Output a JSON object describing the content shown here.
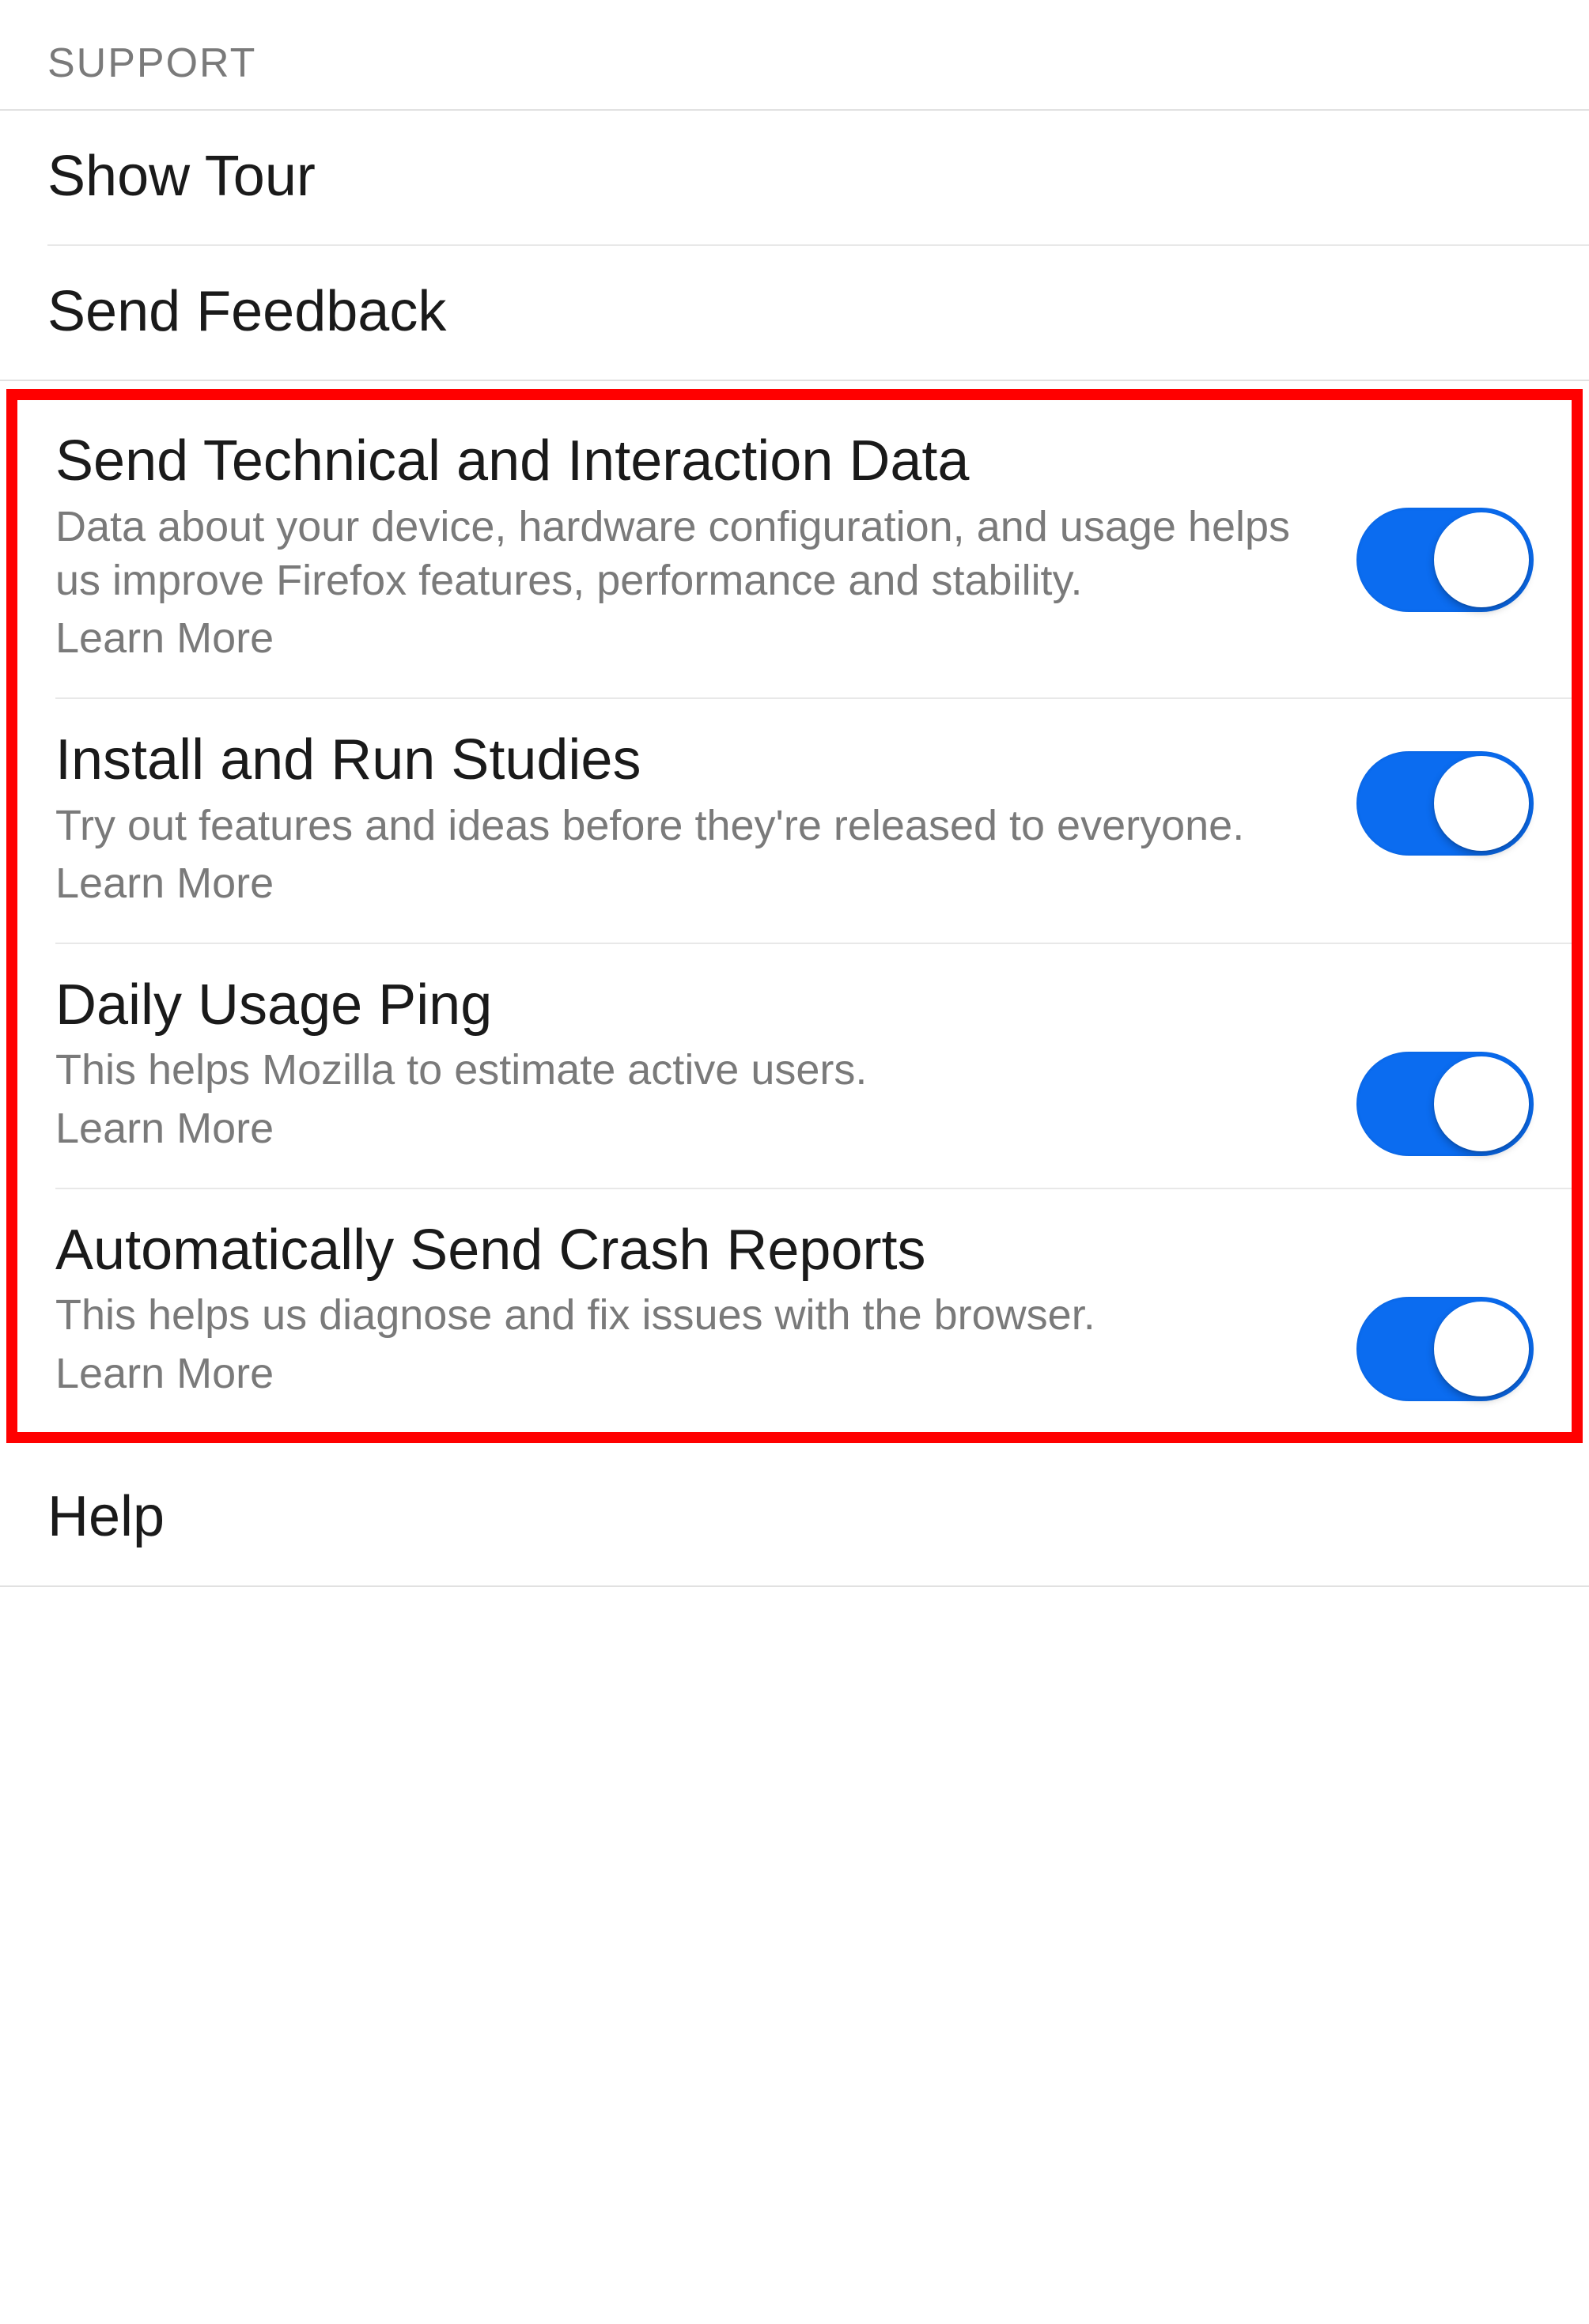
{
  "section_header": "SUPPORT",
  "simple_rows": {
    "show_tour": "Show Tour",
    "send_feedback": "Send Feedback",
    "help": "Help"
  },
  "toggle_rows": [
    {
      "title": "Send Technical and Interaction Data",
      "desc": "Data about your device, hardware configuration, and usage helps us improve Firefox features, performance and stability.",
      "learn_more": "Learn More",
      "on": true
    },
    {
      "title": "Install and Run Studies",
      "desc": "Try out features and ideas before they're released to everyone.",
      "learn_more": "Learn More",
      "on": true
    },
    {
      "title": "Daily Usage Ping",
      "desc": "This helps Mozilla to estimate active users.",
      "learn_more": "Learn More",
      "on": true
    },
    {
      "title": "Automatically Send Crash Reports",
      "desc": "This helps us diagnose and fix issues with the browser.",
      "learn_more": "Learn More",
      "on": true
    }
  ]
}
